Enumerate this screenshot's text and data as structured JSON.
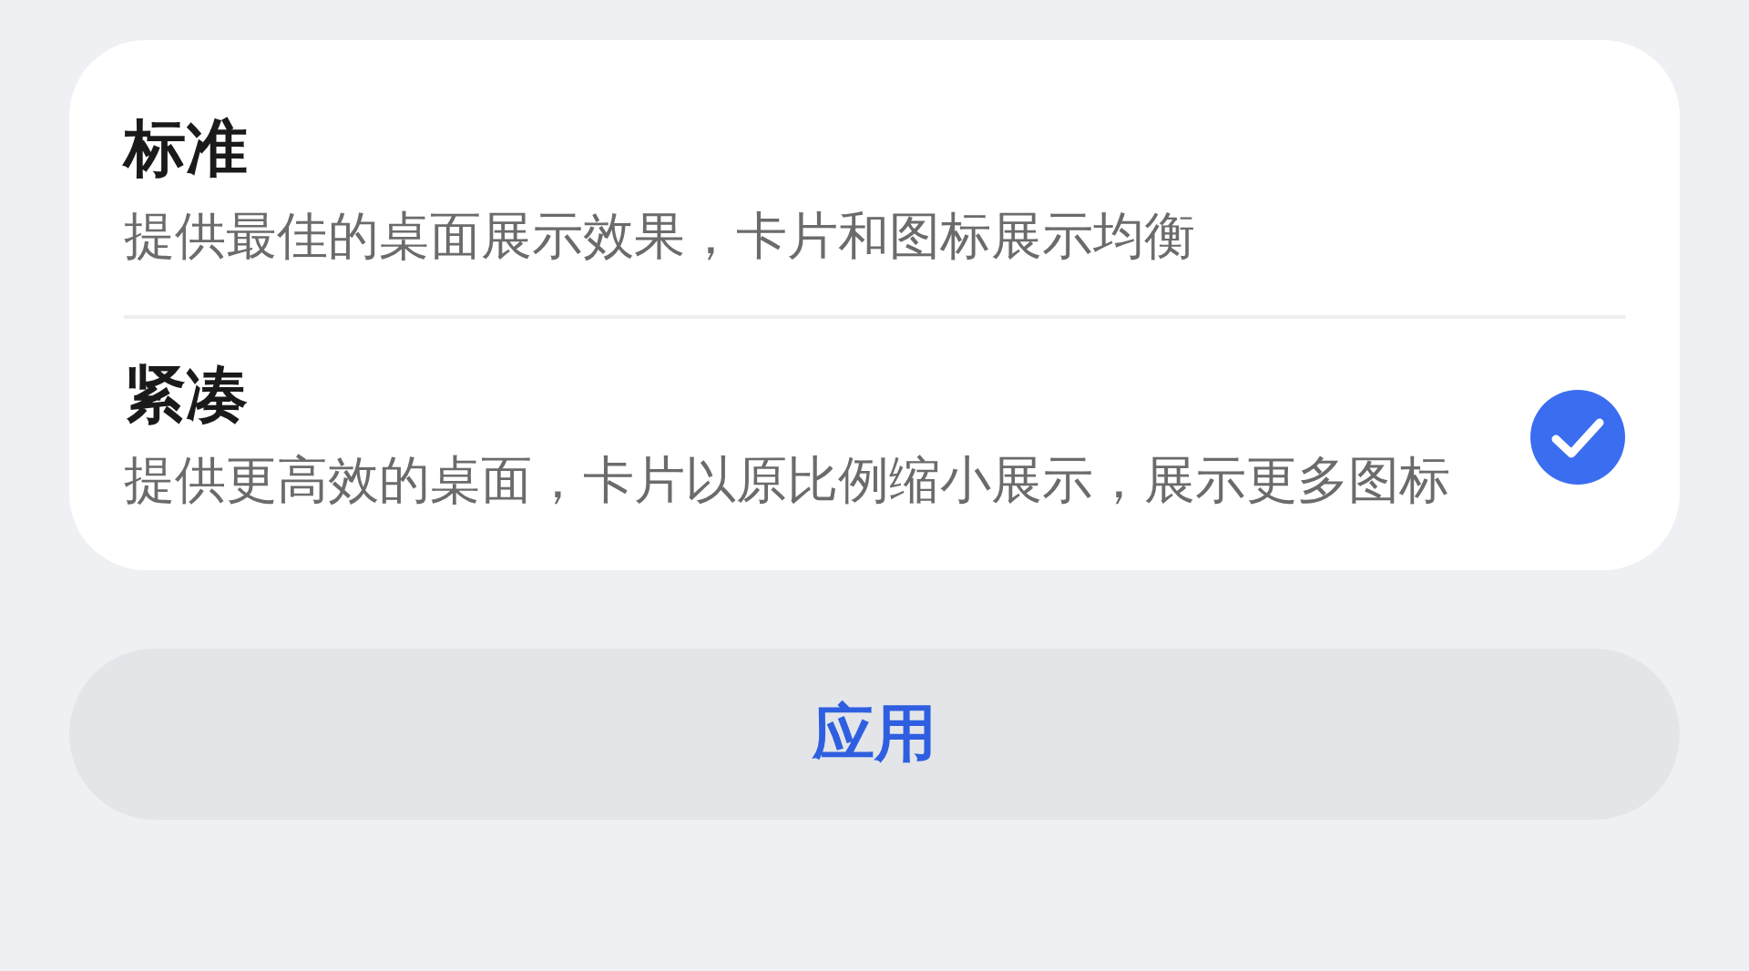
{
  "options": [
    {
      "title": "标准",
      "description": "提供最佳的桌面展示效果，卡片和图标展示均衡",
      "selected": false
    },
    {
      "title": "紧凑",
      "description": "提供更高效的桌面，卡片以原比例缩小展示，展示更多图标",
      "selected": true
    }
  ],
  "apply_button": "应用"
}
